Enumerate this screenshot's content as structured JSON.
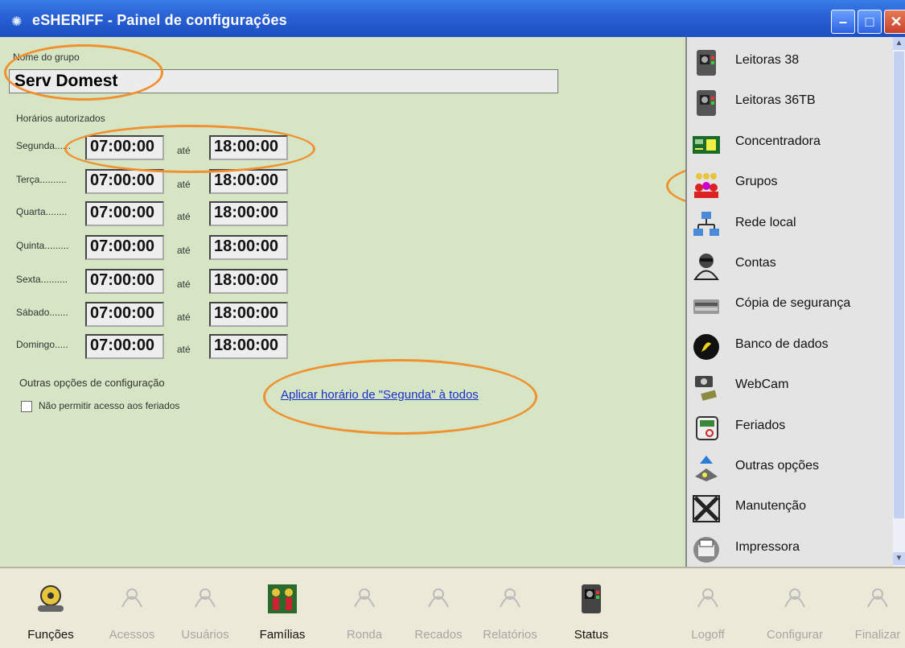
{
  "window": {
    "title": "eSHERIFF - Painel de configurações"
  },
  "form": {
    "group_name_label": "Nome do grupo",
    "group_name_value": "Serv Domest",
    "hours_label": "Horários autorizados",
    "ate": "até",
    "days": [
      {
        "label": "Segunda......",
        "start": "07:00:00",
        "end": "18:00:00"
      },
      {
        "label": "Terça..........",
        "start": "07:00:00",
        "end": "18:00:00"
      },
      {
        "label": "Quarta........",
        "start": "07:00:00",
        "end": "18:00:00"
      },
      {
        "label": "Quinta.........",
        "start": "07:00:00",
        "end": "18:00:00"
      },
      {
        "label": "Sexta..........",
        "start": "07:00:00",
        "end": "18:00:00"
      },
      {
        "label": "Sábado.......",
        "start": "07:00:00",
        "end": "18:00:00"
      },
      {
        "label": "Domingo.....",
        "start": "07:00:00",
        "end": "18:00:00"
      }
    ],
    "other_options_label": "Outras opções de configuração",
    "holiday_checkbox_label": "Não permitir acesso aos feriados",
    "holiday_checkbox_checked": false,
    "apply_link": "Aplicar horário de \"Segunda\" à todos"
  },
  "sidebar": {
    "items": [
      {
        "label": "Leitoras 38",
        "icon": "reader-device-icon"
      },
      {
        "label": "Leitoras 36TB",
        "icon": "reader-device-icon"
      },
      {
        "label": "Concentradora",
        "icon": "circuit-board-icon"
      },
      {
        "label": "Grupos",
        "icon": "group-people-icon"
      },
      {
        "label": "Rede local",
        "icon": "network-icon"
      },
      {
        "label": "Contas",
        "icon": "account-icon"
      },
      {
        "label": "Cópia de segurança",
        "icon": "backup-icon"
      },
      {
        "label": "Banco de dados",
        "icon": "database-icon"
      },
      {
        "label": "WebCam",
        "icon": "webcam-icon"
      },
      {
        "label": "Feriados",
        "icon": "calendar-icon"
      },
      {
        "label": "Outras opções",
        "icon": "options-icon"
      },
      {
        "label": "Manutenção",
        "icon": "maintenance-icon"
      },
      {
        "label": "Impressora",
        "icon": "printer-icon"
      }
    ]
  },
  "toolbar": {
    "items": [
      {
        "label": "Funções",
        "enabled": true
      },
      {
        "label": "Acessos",
        "enabled": false
      },
      {
        "label": "Usuários",
        "enabled": false
      },
      {
        "label": "Famílias",
        "enabled": true
      },
      {
        "label": "Ronda",
        "enabled": false
      },
      {
        "label": "Recados",
        "enabled": false
      },
      {
        "label": "Relatórios",
        "enabled": false
      },
      {
        "label": "Status",
        "enabled": true
      },
      {
        "label": "Logoff",
        "enabled": false
      },
      {
        "label": "Configurar",
        "enabled": false
      },
      {
        "label": "Finalizar",
        "enabled": false
      }
    ]
  },
  "colors": {
    "accent_highlight": "#f09030",
    "link": "#1a2ec8",
    "panel_bg": "#d6e6c4"
  }
}
